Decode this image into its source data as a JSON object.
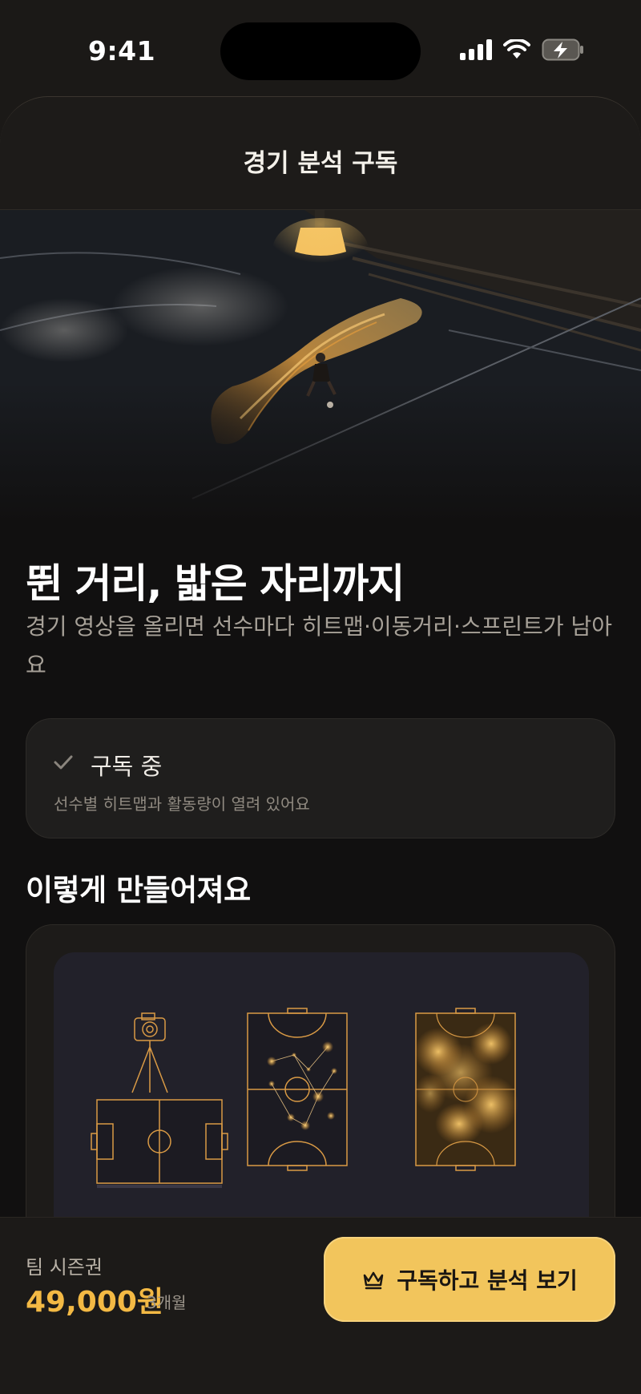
{
  "status_bar": {
    "time": "9:41",
    "icons": [
      "cellular-signal-icon",
      "wifi-icon",
      "battery-charging-icon"
    ]
  },
  "header": {
    "title": "경기 분석 구독"
  },
  "hero": {
    "image": "futsal-player-motion-trail-hero"
  },
  "intro": {
    "headline": "뛴 거리, 밟은 자리까지",
    "subline": "경기 영상을 올리면 선수마다 히트맵·이동거리·스프린트가 남아요"
  },
  "subscription_status": {
    "icon": "check-icon",
    "title": "구독 중",
    "description": "선수별 히트맵과 활동량이 열려 있어요"
  },
  "process": {
    "title": "이렇게 만들어져요",
    "steps": [
      "camera-tripod-pitch-icon",
      "pitch-tracking-points-icon",
      "pitch-heatmap-icon"
    ]
  },
  "purchase": {
    "plan_label": "팀 시즌권",
    "price": "49,000원",
    "period": "3개월",
    "cta_label": "구독하고 분석 보기",
    "cta_icon": "crown-icon"
  },
  "colors": {
    "accent": "#F2C55C",
    "price": "#F3B944",
    "background": "#111010",
    "card": "#1F1E1D"
  }
}
